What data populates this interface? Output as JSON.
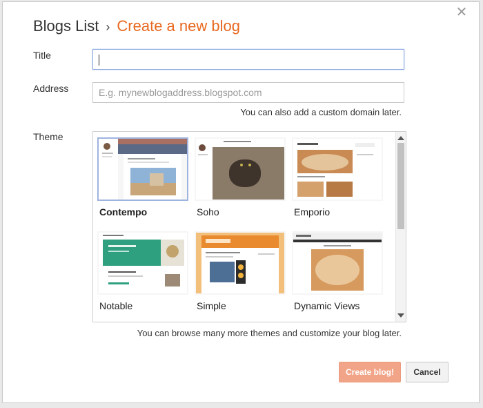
{
  "header": {
    "crumb": "Blogs List",
    "separator": "›",
    "current": "Create a new blog"
  },
  "form": {
    "title_label": "Title",
    "title_value": "",
    "address_label": "Address",
    "address_placeholder": "E.g. mynewblogaddress.blogspot.com",
    "address_hint": "You can also add a custom domain later.",
    "theme_label": "Theme",
    "theme_hint": "You can browse many more themes and customize your blog later."
  },
  "themes": [
    {
      "name": "Contempo",
      "selected": true
    },
    {
      "name": "Soho",
      "selected": false
    },
    {
      "name": "Emporio",
      "selected": false
    },
    {
      "name": "Notable",
      "selected": false
    },
    {
      "name": "Simple",
      "selected": false
    },
    {
      "name": "Dynamic Views",
      "selected": false
    }
  ],
  "buttons": {
    "create": "Create blog!",
    "cancel": "Cancel"
  },
  "icons": {
    "close": "close-icon"
  },
  "colors": {
    "accent": "#e8681f",
    "primary_button": "#f2a488",
    "focus_border": "#8aa8e0"
  }
}
